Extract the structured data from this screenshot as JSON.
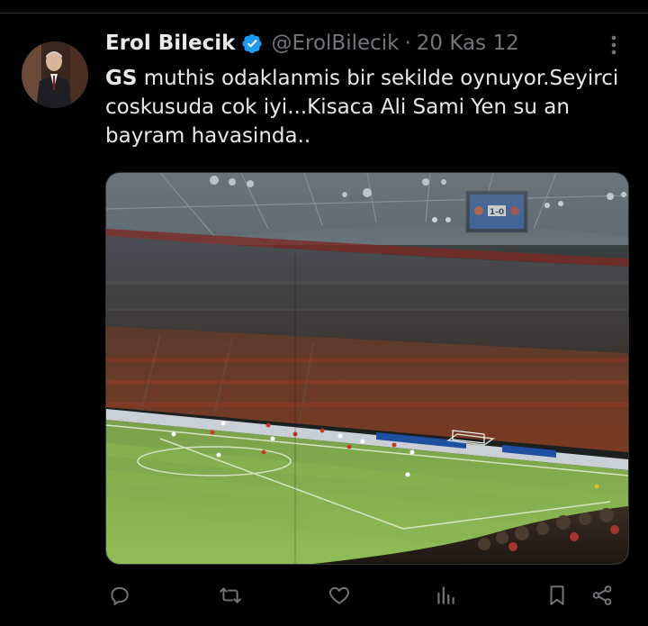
{
  "tweet": {
    "author": {
      "display_name": "Erol Bilecik",
      "handle": "@ErolBilecik",
      "verified": true,
      "avatar_icon": "profile-photo"
    },
    "separator": "·",
    "date": "20 Kas 12",
    "text_bold": "GS",
    "text_rest": " muthis odaklanmis bir sekilde oynuyor.Seyirci coskusuda cok iyi...Kisaca Ali Sami Yen su an bayram havasinda..",
    "media": {
      "kind": "photo",
      "scoreboard": "1-0"
    },
    "actions": [
      {
        "icon": "reply-icon"
      },
      {
        "icon": "retweet-icon"
      },
      {
        "icon": "like-icon"
      },
      {
        "icon": "views-icon"
      },
      {
        "icon": "bookmark-icon"
      },
      {
        "icon": "share-icon"
      }
    ]
  },
  "colors": {
    "background": "#000000",
    "text_primary": "#e7e9ea",
    "text_secondary": "#71767b",
    "verified_badge": "#1d9bf0",
    "divider": "#2f3336"
  }
}
